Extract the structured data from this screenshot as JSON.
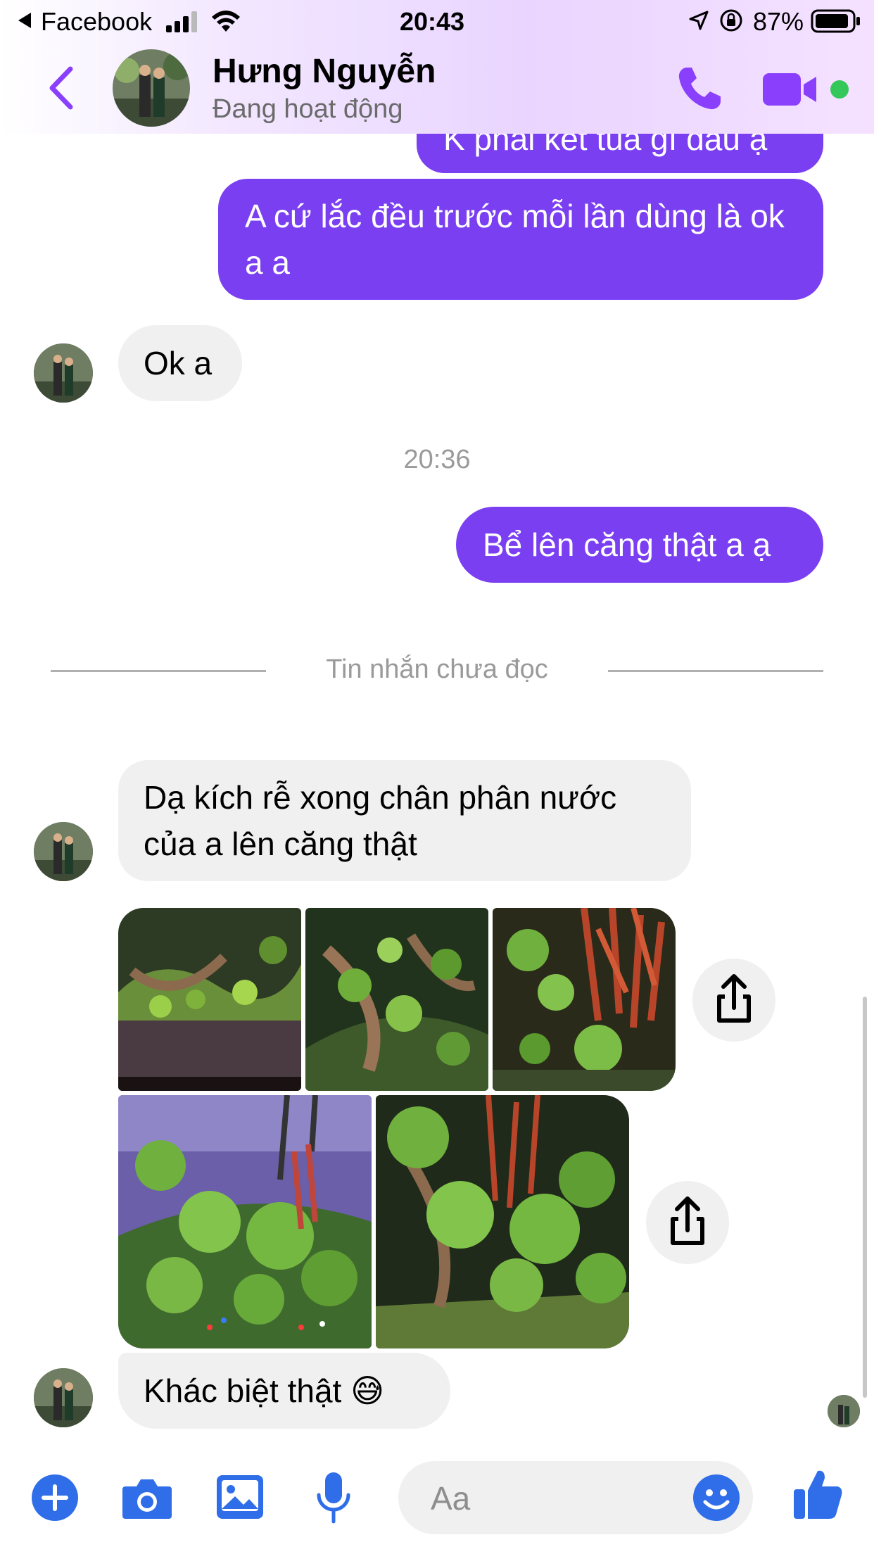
{
  "status_bar": {
    "back_app": "Facebook",
    "time": "20:43",
    "battery": "87%"
  },
  "header": {
    "contact_name": "Hưng Nguyễn",
    "status": "Đang hoạt động",
    "accent_color": "#8a3ffc",
    "online_color": "#34c759"
  },
  "messages": {
    "partial_out": "K phải kết tủa gì đâu ạ",
    "out_1": "A cứ lắc đều trước mỗi lần dùng là ok a a",
    "in_1": "Ok a",
    "time_divider": "20:36",
    "out_2": "Bể lên căng thật a ạ",
    "unread_divider": "Tin nhắn chưa đọc",
    "in_2": "Dạ kích rễ xong chân phân nước của a lên căng thật",
    "in_3": "Khác biệt thật",
    "in_3_emoji": "😅"
  },
  "composer": {
    "placeholder": "Aa",
    "icons": [
      "plus-icon",
      "camera-icon",
      "gallery-icon",
      "microphone-icon",
      "emoji-icon",
      "thumbs-up-icon"
    ],
    "icon_color": "#2f6ee8"
  }
}
